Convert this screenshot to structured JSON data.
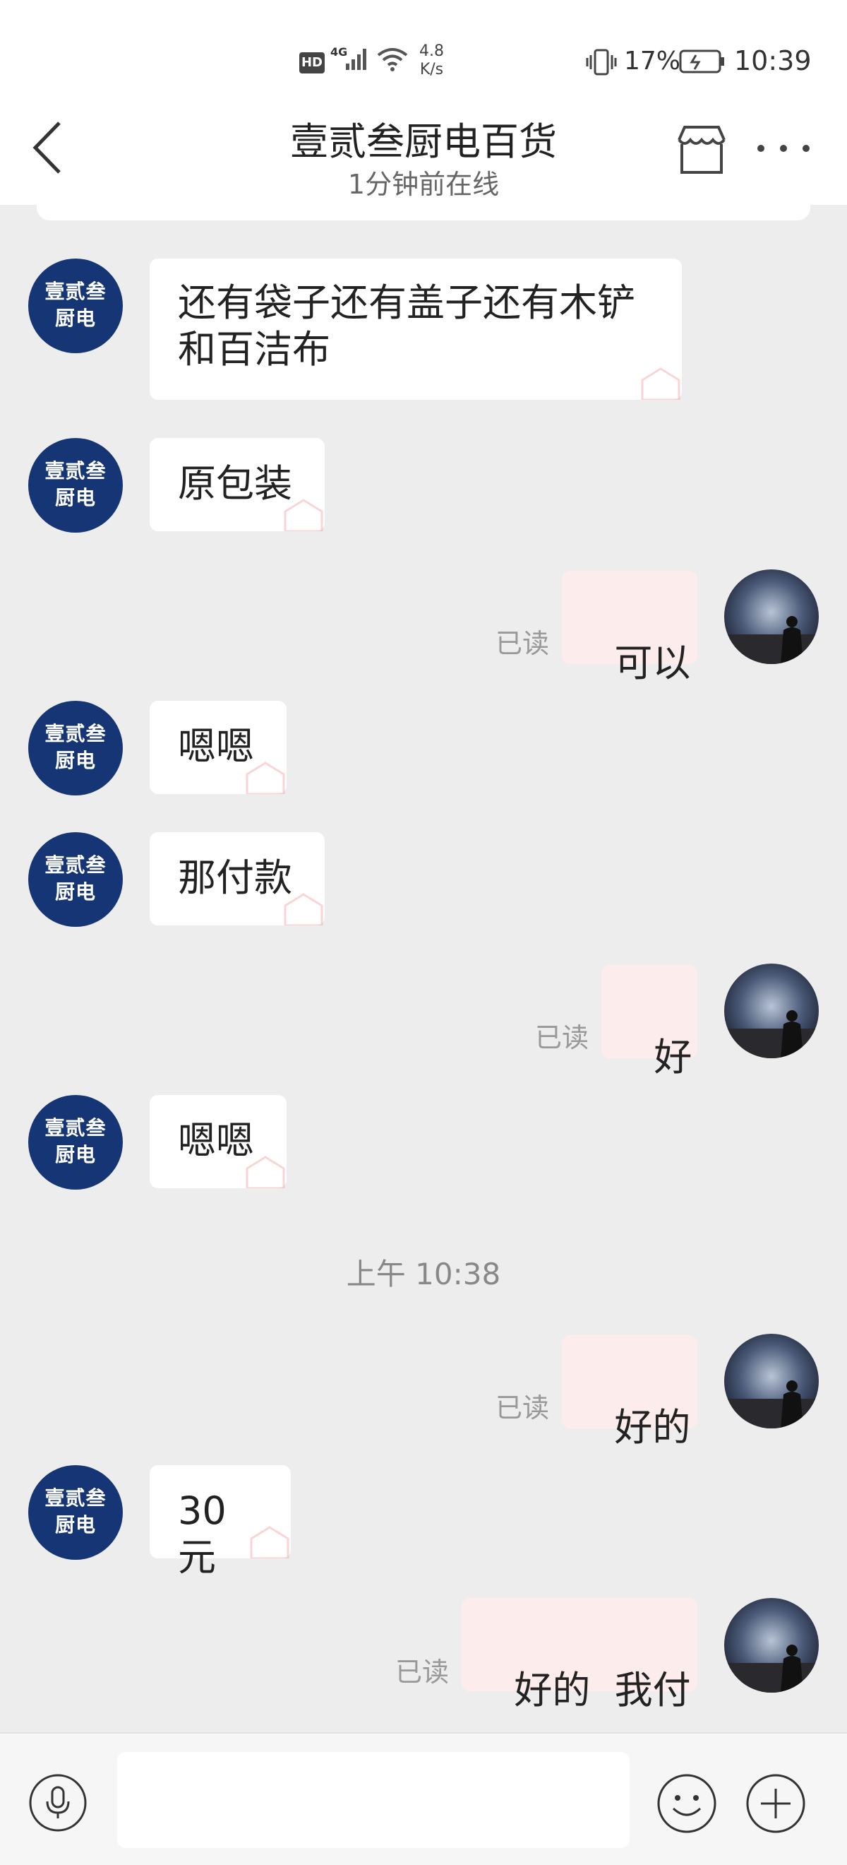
{
  "status_bar": {
    "hd": "HD",
    "network": "4G",
    "speed_value": "4.8",
    "speed_unit": "K/s",
    "battery": "17%",
    "time": "10:39"
  },
  "header": {
    "title": "壹贰叁厨电百货",
    "subtitle": "1分钟前在线",
    "icons": [
      "back-icon",
      "store-icon",
      "more-icon"
    ]
  },
  "shop_avatar": {
    "line1": "壹贰叁",
    "line2": "厨电"
  },
  "messages": [
    {
      "side": "in",
      "text_line1": "还有袋子还有盖子还有木铲",
      "text_line2": "和百洁布"
    },
    {
      "side": "in",
      "text": "原包装"
    },
    {
      "side": "out",
      "text": "可以",
      "status": "已读"
    },
    {
      "side": "in",
      "text": "嗯嗯"
    },
    {
      "side": "in",
      "text": "那付款"
    },
    {
      "side": "out",
      "text": "好",
      "status": "已读"
    },
    {
      "side": "in",
      "text": "嗯嗯"
    },
    {
      "side": "out",
      "text": "好的",
      "status": "已读"
    },
    {
      "side": "in",
      "text": "30元"
    },
    {
      "side": "out",
      "text": "好的  我付",
      "status": "已读"
    }
  ],
  "timestamp": "上午 10:38",
  "input_bar": {
    "placeholder": "",
    "icons": [
      "microphone-icon",
      "emoji-icon",
      "plus-icon"
    ]
  },
  "colors": {
    "shop_avatar_bg": "#163574",
    "outgoing_bubble": "#fdecec",
    "incoming_bubble": "#ffffff",
    "background": "#ededed"
  }
}
